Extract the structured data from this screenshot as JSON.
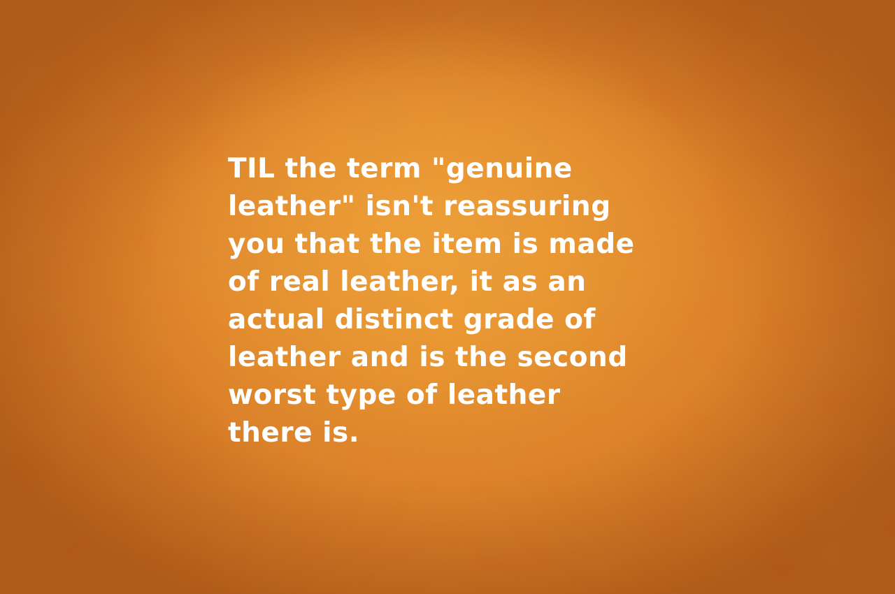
{
  "quote": {
    "lines": [
      "TIL the term \"genuine",
      "leather\" isn't reassuring",
      "you that the item is made",
      "of real leather, it as an",
      "actual distinct grade of",
      "leather and is the second",
      "worst type of leather",
      "there is."
    ]
  },
  "colors": {
    "background": "#e98d2e",
    "text": "#ffffff"
  }
}
